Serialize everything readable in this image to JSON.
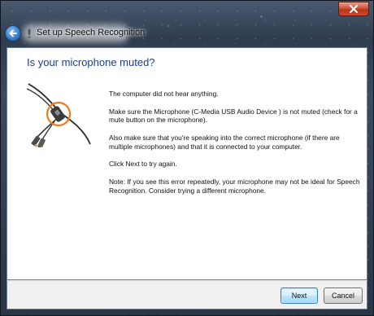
{
  "window": {
    "title": "Set up Speech Recognition",
    "close_glyph": "✕"
  },
  "page": {
    "heading": "Is your microphone muted?",
    "paragraphs": [
      "The computer did not hear anything.",
      "Make sure the Microphone (C-Media USB Audio Device   ) is not muted (check for a mute button on the microphone).",
      " Also make sure that you're speaking into the correct microphone (if there are multiple microphones) and that it is connected to your computer.",
      "Click Next to try again.",
      "Note: If you see this error repeatedly, your microphone may not be ideal for Speech Recognition. Consider trying a different microphone."
    ]
  },
  "buttons": {
    "next": "Next",
    "cancel": "Cancel"
  },
  "colors": {
    "heading": "#1e3c8c",
    "highlight_circle": "#f07a1a",
    "close_red": "#c8442a"
  },
  "icons": [
    "back-arrow-icon",
    "microphone-icon",
    "close-icon",
    "microphone-cable-illustration"
  ]
}
